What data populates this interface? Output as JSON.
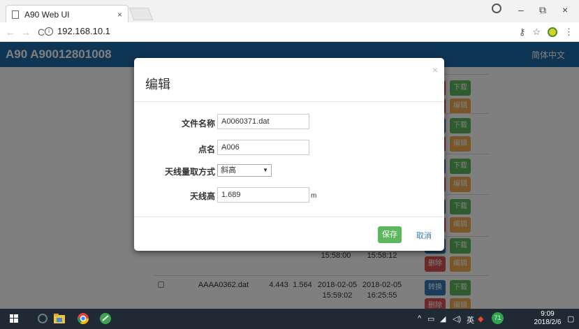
{
  "browser": {
    "tab_title": "A90 Web UI",
    "tab_close": "×",
    "url": "192.168.10.1",
    "back": "←",
    "forward": "→",
    "reload": "C",
    "key_icon": "⚷",
    "star_icon": "☆",
    "menu_icon": "⋮",
    "min": "–",
    "restore": "⧉",
    "close": "×"
  },
  "app": {
    "title": "A90  A90012801008",
    "language": "简体中文"
  },
  "table": {
    "visible_rows": [
      {
        "actions": [
          "下载",
          "编辑"
        ]
      },
      {
        "actions": [
          "下载",
          "编辑"
        ]
      },
      {
        "actions": [
          "下载",
          "编辑"
        ]
      },
      {
        "actions": [
          "下载",
          "编辑"
        ]
      },
      {
        "start_time_tail": "15:58:00",
        "end_time_tail": "15:58:12",
        "actions": [
          "下载",
          "删除",
          "编辑"
        ]
      },
      {
        "filename": "AAAA0362.dat",
        "v1": "4.443",
        "v2": "1.564",
        "start": "2018-02-05 15:59:02",
        "end": "2018-02-05 16:25:55",
        "actions": [
          "转换",
          "下载",
          "删除",
          "编辑"
        ]
      }
    ]
  },
  "modal": {
    "title": "编辑",
    "close": "×",
    "fields": {
      "filename_label": "文件名称",
      "filename_value": "A0060371.dat",
      "point_label": "点名",
      "point_value": "A006",
      "antenna_method_label": "天线量取方式",
      "antenna_method_value": "斜高",
      "antenna_height_label": "天线高",
      "antenna_height_value": "1.689",
      "antenna_height_unit": "m"
    },
    "save": "保存",
    "cancel": "取消"
  },
  "taskbar": {
    "time": "9:09",
    "date": "2018/2/6",
    "ime": "英",
    "badge": "71"
  },
  "colors": {
    "header": "#1e6aa8",
    "green": "#5cb85c",
    "orange": "#f0ad4e",
    "red": "#d9534f",
    "blue": "#337ab7"
  }
}
